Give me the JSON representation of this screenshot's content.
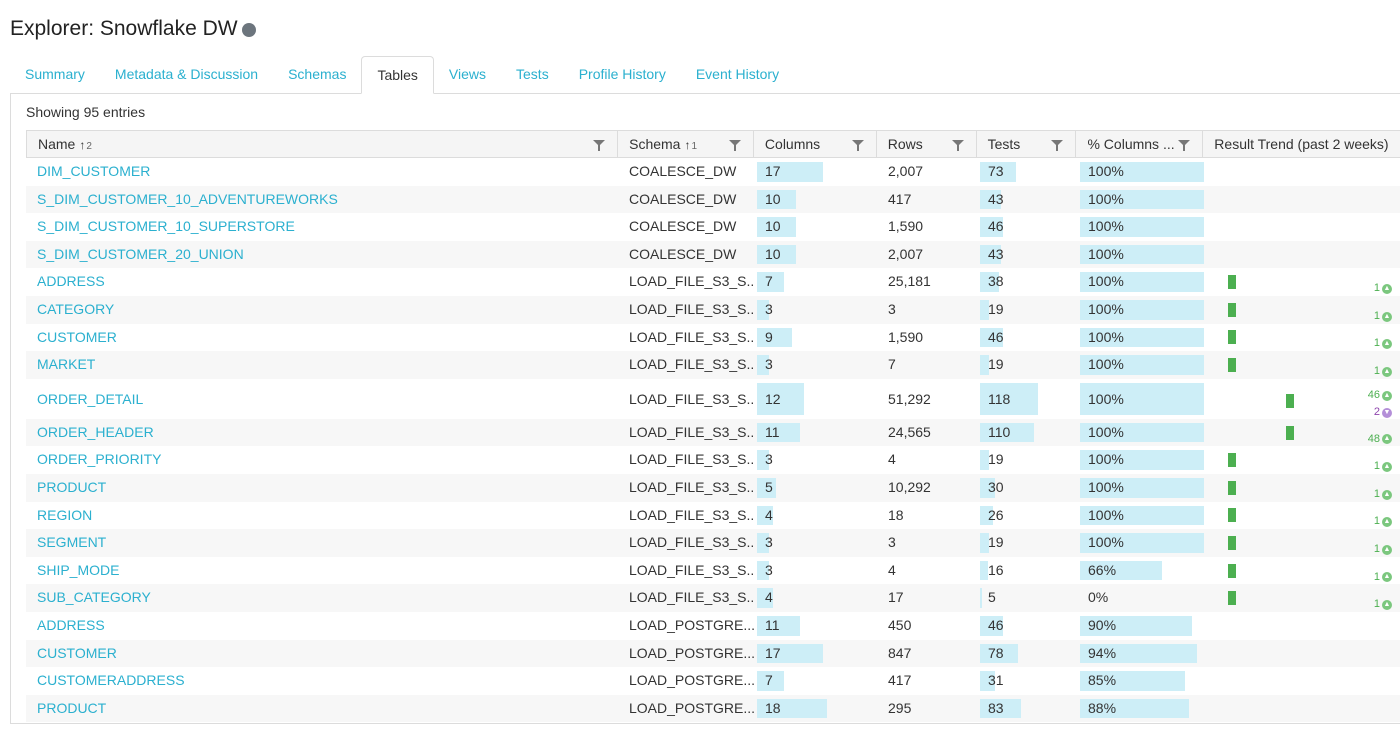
{
  "header": {
    "title": "Explorer: Snowflake DW"
  },
  "tabs": [
    "Summary",
    "Metadata & Discussion",
    "Schemas",
    "Tables",
    "Views",
    "Tests",
    "Profile History",
    "Event History"
  ],
  "active_tab": "Tables",
  "showing": "Showing 95 entries",
  "columns": [
    {
      "label": "Name",
      "sort": "↑",
      "sort_order": "2"
    },
    {
      "label": "Schema",
      "sort": "↑",
      "sort_order": "1"
    },
    {
      "label": "Columns"
    },
    {
      "label": "Rows"
    },
    {
      "label": "Tests"
    },
    {
      "label": "% Columns ..."
    },
    {
      "label": "Result Trend (past 2 weeks)"
    }
  ],
  "rows": [
    {
      "name": "DIM_CUSTOMER",
      "schema": "COALESCE_DW",
      "columns": "17",
      "rows": "2,007",
      "tests": "73",
      "pct": "100%"
    },
    {
      "name": "S_DIM_CUSTOMER_10_ADVENTUREWORKS",
      "schema": "COALESCE_DW",
      "columns": "10",
      "rows": "417",
      "tests": "43",
      "pct": "100%"
    },
    {
      "name": "S_DIM_CUSTOMER_10_SUPERSTORE",
      "schema": "COALESCE_DW",
      "columns": "10",
      "rows": "1,590",
      "tests": "46",
      "pct": "100%"
    },
    {
      "name": "S_DIM_CUSTOMER_20_UNION",
      "schema": "COALESCE_DW",
      "columns": "10",
      "rows": "2,007",
      "tests": "43",
      "pct": "100%"
    },
    {
      "name": "ADDRESS",
      "schema": "LOAD_FILE_S3_S...",
      "columns": "7",
      "rows": "25,181",
      "tests": "38",
      "pct": "100%",
      "trend": {
        "pass": "1"
      }
    },
    {
      "name": "CATEGORY",
      "schema": "LOAD_FILE_S3_S...",
      "columns": "3",
      "rows": "3",
      "tests": "19",
      "pct": "100%",
      "trend": {
        "pass": "1"
      }
    },
    {
      "name": "CUSTOMER",
      "schema": "LOAD_FILE_S3_S...",
      "columns": "9",
      "rows": "1,590",
      "tests": "46",
      "pct": "100%",
      "trend": {
        "pass": "1"
      }
    },
    {
      "name": "MARKET",
      "schema": "LOAD_FILE_S3_S...",
      "columns": "3",
      "rows": "7",
      "tests": "19",
      "pct": "100%",
      "trend": {
        "pass": "1"
      }
    },
    {
      "name": "ORDER_DETAIL",
      "schema": "LOAD_FILE_S3_S...",
      "columns": "12",
      "rows": "51,292",
      "tests": "118",
      "pct": "100%",
      "trend": {
        "pass": "46",
        "fail": "2"
      }
    },
    {
      "name": "ORDER_HEADER",
      "schema": "LOAD_FILE_S3_S...",
      "columns": "11",
      "rows": "24,565",
      "tests": "110",
      "pct": "100%",
      "trend": {
        "pass": "48"
      }
    },
    {
      "name": "ORDER_PRIORITY",
      "schema": "LOAD_FILE_S3_S...",
      "columns": "3",
      "rows": "4",
      "tests": "19",
      "pct": "100%",
      "trend": {
        "pass": "1"
      }
    },
    {
      "name": "PRODUCT",
      "schema": "LOAD_FILE_S3_S...",
      "columns": "5",
      "rows": "10,292",
      "tests": "30",
      "pct": "100%",
      "trend": {
        "pass": "1"
      }
    },
    {
      "name": "REGION",
      "schema": "LOAD_FILE_S3_S...",
      "columns": "4",
      "rows": "18",
      "tests": "26",
      "pct": "100%",
      "trend": {
        "pass": "1"
      }
    },
    {
      "name": "SEGMENT",
      "schema": "LOAD_FILE_S3_S...",
      "columns": "3",
      "rows": "3",
      "tests": "19",
      "pct": "100%",
      "trend": {
        "pass": "1"
      }
    },
    {
      "name": "SHIP_MODE",
      "schema": "LOAD_FILE_S3_S...",
      "columns": "3",
      "rows": "4",
      "tests": "16",
      "pct": "66%",
      "trend": {
        "pass": "1"
      }
    },
    {
      "name": "SUB_CATEGORY",
      "schema": "LOAD_FILE_S3_S...",
      "columns": "4",
      "rows": "17",
      "tests": "5",
      "pct": "0%",
      "trend": {
        "pass": "1"
      }
    },
    {
      "name": "ADDRESS",
      "schema": "LOAD_POSTGRE...",
      "columns": "11",
      "rows": "450",
      "tests": "46",
      "pct": "90%"
    },
    {
      "name": "CUSTOMER",
      "schema": "LOAD_POSTGRE...",
      "columns": "17",
      "rows": "847",
      "tests": "78",
      "pct": "94%"
    },
    {
      "name": "CUSTOMERADDRESS",
      "schema": "LOAD_POSTGRE...",
      "columns": "7",
      "rows": "417",
      "tests": "31",
      "pct": "85%"
    },
    {
      "name": "PRODUCT",
      "schema": "LOAD_POSTGRE...",
      "columns": "18",
      "rows": "295",
      "tests": "83",
      "pct": "88%"
    }
  ],
  "colors": {
    "link": "#2bb0cf",
    "bar": "#cdeef7",
    "pass": "#4caf50",
    "fail": "#8e44ad",
    "status_dot": "#6c757d"
  },
  "icons": {
    "filter": "filter-icon",
    "pass": "arrow-up-circle-icon",
    "fail": "arrow-down-circle-icon"
  }
}
